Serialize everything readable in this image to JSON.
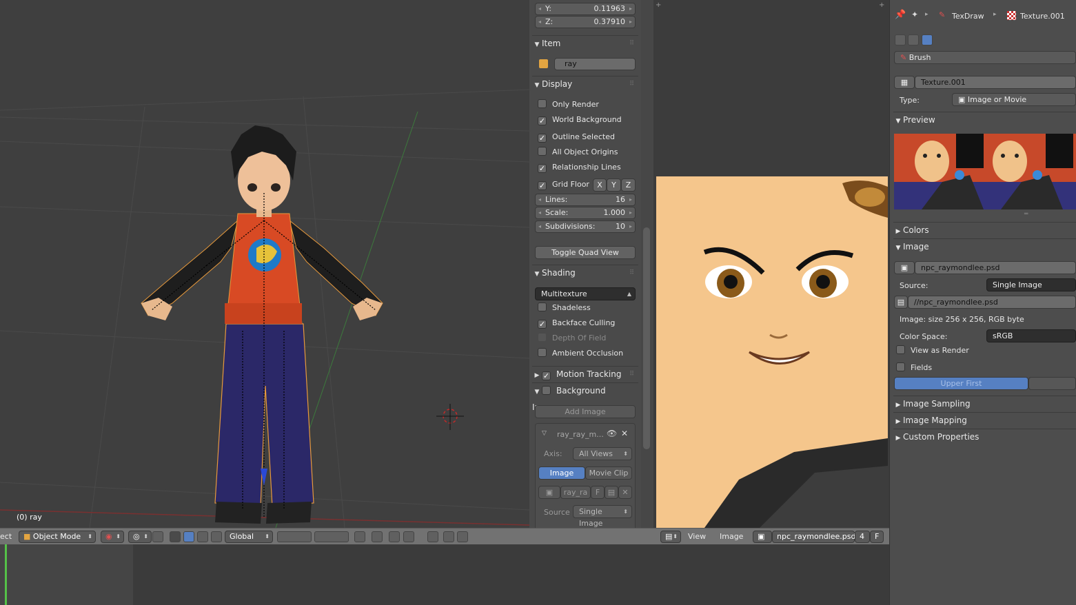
{
  "viewport": {
    "object_label": "(0) ray"
  },
  "npanel": {
    "transform": {
      "y_label": "Y:",
      "y_value": "0.11963",
      "z_label": "Z:",
      "z_value": "0.37910"
    },
    "item": {
      "title": "Item",
      "name": "ray"
    },
    "display": {
      "title": "Display",
      "only_render": "Only Render",
      "world_background": "World Background",
      "outline_selected": "Outline Selected",
      "all_object_origins": "All Object Origins",
      "relationship_lines": "Relationship Lines",
      "grid_floor": "Grid Floor",
      "axis_x": "X",
      "axis_y": "Y",
      "axis_z": "Z",
      "lines_label": "Lines:",
      "lines_value": "16",
      "scale_label": "Scale:",
      "scale_value": "1.000",
      "subdiv_label": "Subdivisions:",
      "subdiv_value": "10",
      "toggle_quad": "Toggle Quad View"
    },
    "shading": {
      "title": "Shading",
      "mode": "Multitexture",
      "shadeless": "Shadeless",
      "backface_culling": "Backface Culling",
      "depth_of_field": "Depth Of Field",
      "ambient_occlusion": "Ambient Occlusion"
    },
    "motion_tracking": "Motion Tracking",
    "background_images": {
      "title": "Background Images",
      "add_image": "Add Image",
      "entry_name": "ray_ray_m...",
      "axis_label": "Axis:",
      "axis_value": "All Views",
      "tab_image": "Image",
      "tab_movie_clip": "Movie Clip",
      "image_name": "ray_ra",
      "fake_user": "F",
      "source_label": "Source",
      "source_value": "Single Image"
    }
  },
  "viewport_header": {
    "edge_text": "ect",
    "mode": "Object Mode",
    "orientation": "Global"
  },
  "image_header": {
    "view": "View",
    "image": "Image",
    "image_name": "npc_raymondlee.psd",
    "users": "4",
    "fake": "F"
  },
  "properties": {
    "breadcrumb_texdraw": "TexDraw",
    "breadcrumb_texture": "Texture.001",
    "brush": "Brush",
    "texture_name": "Texture.001",
    "type_label": "Type:",
    "type_value": "Image or Movie",
    "preview": "Preview",
    "colors": "Colors",
    "image_section": "Image",
    "image_name": "npc_raymondlee.psd",
    "source_label": "Source:",
    "source_value": "Single Image",
    "filepath": "//npc_raymondlee.psd",
    "image_info": "Image: size 256 x 256, RGB byte",
    "color_space_label": "Color Space:",
    "color_space_value": "sRGB",
    "view_as_render": "View as Render",
    "fields": "Fields",
    "upper_first": "Upper First",
    "image_sampling": "Image Sampling",
    "image_mapping": "Image Mapping",
    "custom_properties": "Custom Properties"
  }
}
